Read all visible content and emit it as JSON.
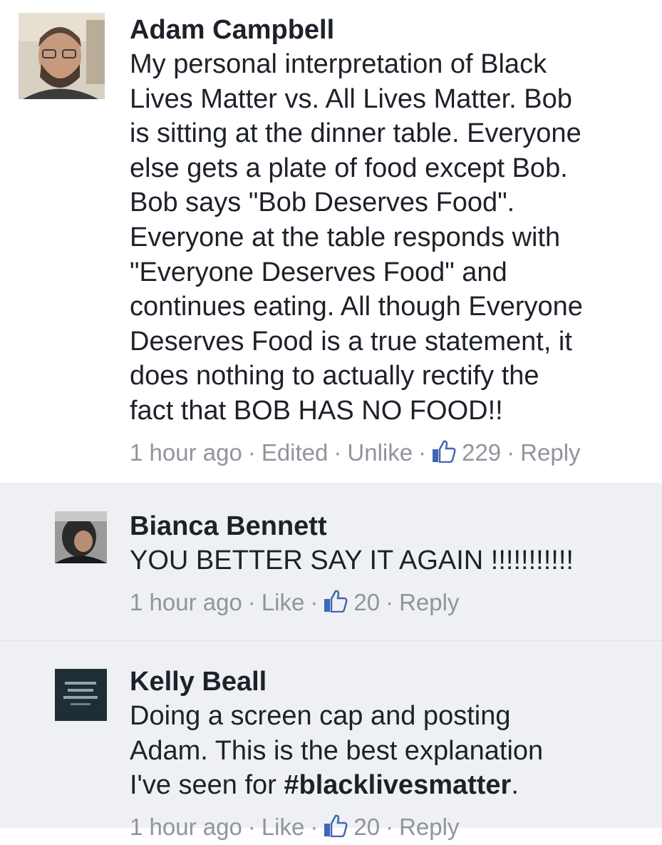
{
  "comments": [
    {
      "author": "Adam Campbell",
      "text": "My personal interpretation of Black\nLives Matter vs. All Lives Matter. Bob\nis sitting at the dinner table. Everyone\nelse gets a plate of food except Bob.\nBob says \"Bob Deserves Food\".\nEveryone at the table responds with\n\"Everyone Deserves Food\" and\ncontinues eating. All though Everyone\nDeserves Food is a true statement, it\ndoes nothing to actually rectify the\nfact that BOB HAS NO FOOD!!",
      "time": "1 hour ago",
      "edited": "Edited",
      "like_action": "Unlike",
      "like_count": "229",
      "reply": "Reply",
      "avatar_icon": "profile-photo-icon"
    },
    {
      "author": "Bianca Bennett",
      "text": "YOU BETTER SAY IT AGAIN !!!!!!!!!!!",
      "time": "1 hour ago",
      "like_action": "Like",
      "like_count": "20",
      "reply": "Reply",
      "avatar_icon": "profile-photo-icon"
    },
    {
      "author": "Kelly Beall",
      "text_before": "Doing a screen cap and posting\nAdam. This is the best explanation\nI've seen for ",
      "hashtag": "#blacklivesmatter",
      "text_after": ".",
      "time": "1 hour ago",
      "like_action": "Like",
      "like_count": "20",
      "reply": "Reply",
      "avatar_icon": "profile-photo-icon"
    }
  ],
  "separator": "·",
  "colors": {
    "name_text": "#1d2129",
    "meta_text": "#90949c",
    "reply_background": "#eef0f4",
    "like_icon": "#4267b2"
  }
}
